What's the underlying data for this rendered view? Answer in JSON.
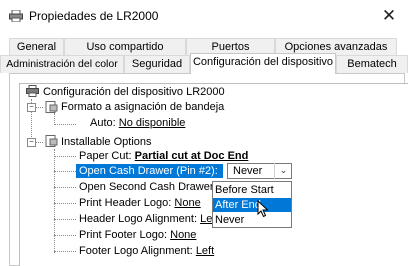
{
  "window": {
    "title": "Propiedades de LR2000",
    "close": "✕"
  },
  "tabs_row1": [
    "General",
    "Uso compartido",
    "Puertos",
    "Opciones avanzadas"
  ],
  "tabs_row2": [
    "Administración del color",
    "Seguridad",
    "Configuración del dispositivo",
    "Bematech"
  ],
  "active_tab": "Configuración del dispositivo",
  "tree": {
    "root": "Configuración del dispositivo LR2000",
    "bandeja": "Formato a asignación de bandeja",
    "auto_label": "Auto:",
    "auto_value": "No disponible",
    "installable": "Installable Options",
    "paper_cut_label": "Paper Cut:",
    "paper_cut_value": "Partial cut at Doc End",
    "drawer1_label": "Open Cash Drawer (Pin #2):",
    "drawer1_value": "Never",
    "drawer2_label": "Open Second Cash Drawer (P",
    "header_logo_label": "Print Header Logo:",
    "header_logo_value": "None",
    "header_align_label": "Header Logo Alignment:",
    "header_align_value": "Left",
    "footer_logo_label": "Print Footer Logo:",
    "footer_logo_value": "None",
    "footer_align_label": "Footer Logo Alignment:",
    "footer_align_value": "Left"
  },
  "dropdown_options": [
    "Before Start",
    "After End",
    "Never"
  ],
  "dropdown_highlighted": "After End",
  "colors": {
    "selection": "#0078d7"
  }
}
